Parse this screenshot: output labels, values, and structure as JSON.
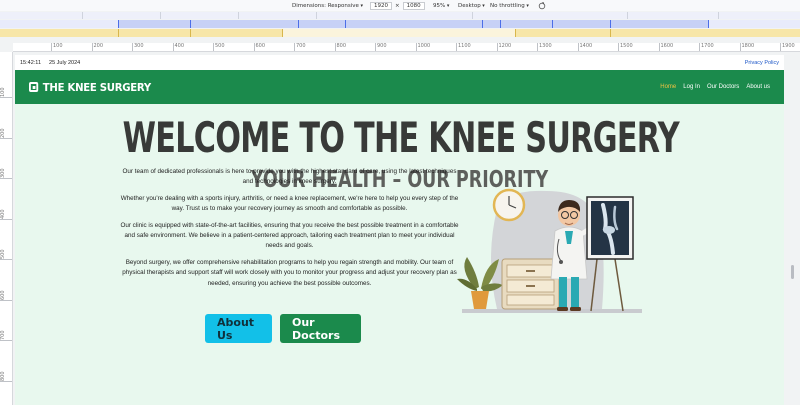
{
  "devtools": {
    "dimensions_label": "Dimensions: Responsive",
    "width": "1920",
    "times": "×",
    "height": "1080",
    "zoom": "95%",
    "device": "Desktop",
    "throttling": "No throttling"
  },
  "ruler": {
    "top_ticks": [
      "100",
      "200",
      "300",
      "400",
      "500",
      "600",
      "700",
      "800",
      "900",
      "1000",
      "1100",
      "1200",
      "1300",
      "1400",
      "1500",
      "1600",
      "1700",
      "1800",
      "1900"
    ],
    "left_ticks": [
      "100",
      "200",
      "300",
      "400",
      "500",
      "600",
      "700",
      "800"
    ]
  },
  "topstrip": {
    "time": "15:42:11",
    "date": "25 July 2024",
    "privacy": "Privacy Policy"
  },
  "navbar": {
    "brand": "THE KNEE SURGERY",
    "links": [
      "Home",
      "Log In",
      "Our Doctors",
      "About us"
    ]
  },
  "hero": {
    "title": "WELCOME TO THE KNEE SURGERY",
    "subtitle": "YOUR HEALTH – OUR PRIORITY"
  },
  "content": {
    "paragraphs": [
      "Our team of dedicated professionals is here to provide you with the highest standard of care, using the latest techniques and technologies in knee surgery.",
      "Whether you're dealing with a sports injury, arthritis, or need a knee replacement, we're here to help you every step of the way. Trust us to make your recovery journey as smooth and comfortable as possible.",
      "Our clinic is equipped with state-of-the-art facilities, ensuring that you receive the best possible treatment in a comfortable and safe environment. We believe in a patient-centered approach, tailoring each treatment plan to meet your individual needs and goals.",
      "Beyond surgery, we offer comprehensive rehabilitation programs to help you regain strength and mobility. Our team of physical therapists and support staff will work closely with you to monitor your progress and adjust your recovery plan as needed, ensuring you achieve the best possible outcomes."
    ]
  },
  "buttons": {
    "about": "About Us",
    "doctors": "Our Doctors"
  },
  "colors": {
    "nav_green": "#1b8a4c",
    "page_bg": "#e8f8ee",
    "accent_cyan": "#12c0e8",
    "active_link": "#f0c242"
  }
}
